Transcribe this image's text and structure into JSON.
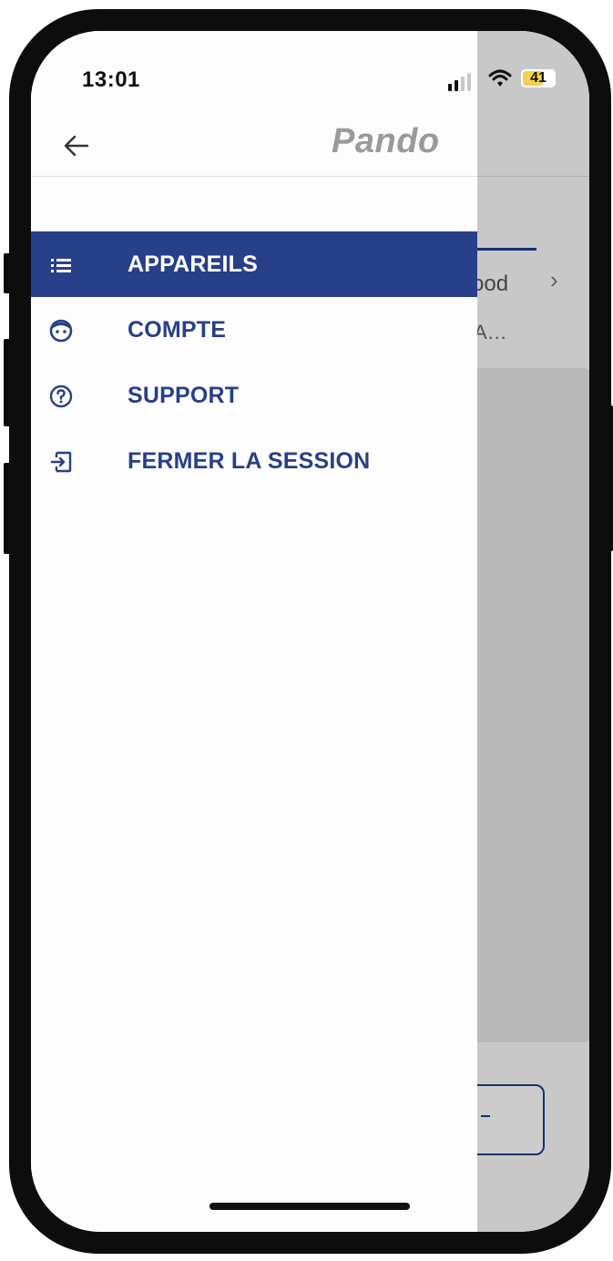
{
  "status_bar": {
    "time": "13:01",
    "battery_level": "41",
    "signal_bars": 2,
    "icons": [
      "cellular-signal-icon",
      "wifi-icon",
      "battery-icon"
    ]
  },
  "header": {
    "back_icon": "arrow-left-icon",
    "logo_text": "Pando"
  },
  "menu": {
    "items": [
      {
        "label": "APPAREILS",
        "icon": "list-icon",
        "active": true
      },
      {
        "label": "COMPTE",
        "icon": "face-icon",
        "active": false
      },
      {
        "label": "SUPPORT",
        "icon": "help-circle-icon",
        "active": false
      },
      {
        "label": "FERMER LA SESSION",
        "icon": "logout-icon",
        "active": false
      }
    ]
  },
  "underlying_screen": {
    "text_fragment_1": "ood",
    "text_fragment_2": "A…",
    "chevron": "›"
  },
  "colors": {
    "accent": "#283f8a",
    "drawer_bg": "#fdfdfd",
    "logo_gray": "#9a9a9a",
    "battery_yellow": "#f2d24e"
  }
}
